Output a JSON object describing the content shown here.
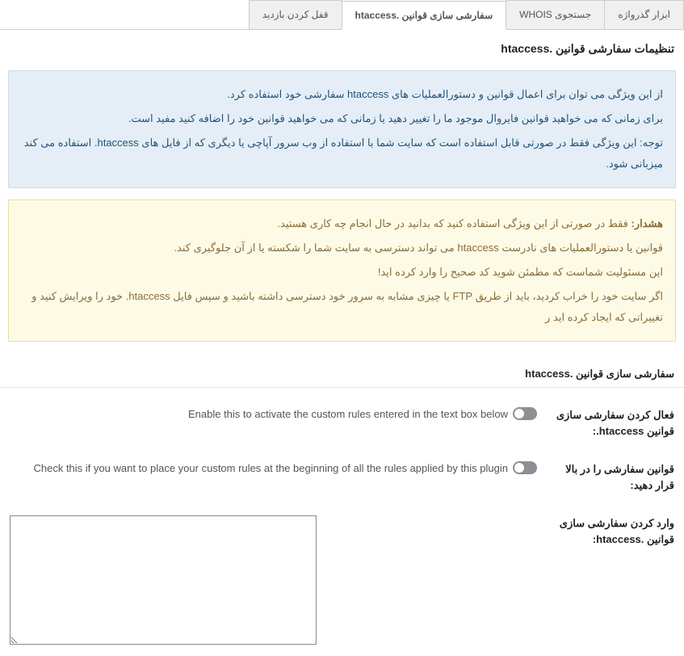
{
  "tabs": [
    {
      "label": "ابزار گذرواژه"
    },
    {
      "label": "جستجوی WHOIS"
    },
    {
      "label": "سفارشی سازی قوانین .htaccess"
    },
    {
      "label": "قفل کردن بازدید"
    }
  ],
  "page_title": "تنظیمات سفارشی قوانین .htaccess",
  "info": {
    "p1": "از این ویژگی می توان برای اعمال قوانین و دستورالعملیات های htaccess سفارشی خود استفاده کرد.",
    "p2": "برای زمانی که می خواهید قوانین فایروال موجود ما را تغییر دهید یا زمانی که می خواهید قوانین خود را اضافه کنید مفید است.",
    "p3": "توجه: این ویژگی فقط در صورتی قابل استفاده است که سایت شما با استفاده از وب سرور آپاچی یا دیگری که از فایل های htaccess. استفاده می کند میزبانی شود."
  },
  "warn": {
    "p1_bold": "هشدار:",
    "p1": " فقط در صورتی از این ویژگی استفاده کنید که بدانید در حال انجام چه کاری هستید.",
    "p2": "قوانین یا دستورالعملیات های نادرست htaccess می تواند دسترسی به سایت شما را شکسته یا از آن جلوگیری کند.",
    "p3": "این مسئولیت شماست که مطمئن شوید کد صحیح را وارد کرده اید!",
    "p4": "اگر سایت خود را خراب کردید، باید از طریق FTP یا چیزی مشابه به سرور خود دسترسی داشته باشید و سپس فایل htaccess. خود را ویرایش کنید و تغییراتی که ایجاد کرده اید ر"
  },
  "section_title": "سفارشی سازی قوانین .htaccess",
  "fields": {
    "enable": {
      "label": "فعال کردن سفارشی سازی قوانین htaccess.:",
      "desc": "Enable this to activate the custom rules entered in the text box below"
    },
    "place_top": {
      "label": "قوانین سفارشی را در بالا قرار دهید:",
      "desc": "Check this if you want to place your custom rules at the beginning of all the rules applied by this plugin"
    },
    "rules": {
      "label": "وارد کردن سفارشی سازی قوانین .htaccess:",
      "value": ""
    }
  }
}
